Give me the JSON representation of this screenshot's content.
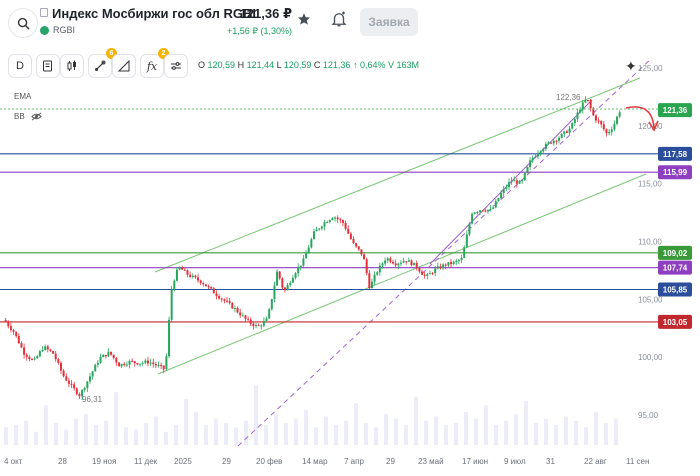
{
  "header": {
    "title": "Индекс Мосбиржи гос обл RGBI",
    "ticker": "RGBI",
    "price": "121,36 ₽",
    "change": "+1,56 ₽ (1,30%)",
    "order_button": "Заявка"
  },
  "toolbar": {
    "d_label": "D",
    "badge_drawing": "6",
    "badge_fx": "2",
    "fx_label": "fx",
    "ohlc": {
      "o_label": "O",
      "o": "120,59",
      "h_label": "H",
      "h": "121,44",
      "l_label": "L",
      "l": "120,59",
      "c_label": "C",
      "c": "121,36",
      "change": "↑ 0,64% V 163M"
    }
  },
  "indicators": {
    "ema": "EMA",
    "bb": "BB"
  },
  "colors": {
    "up": "#26a65b",
    "down": "#e0303a",
    "channel": "#6cc26a",
    "trend": "#9b59d0",
    "blue": "#2a4e9b",
    "red": "#c0282e",
    "green_level": "#3a9a3a",
    "purple_level": "#8e3fbf"
  },
  "annotations": {
    "high_label": "122,36",
    "low_label": "96,31"
  },
  "level_lines": [
    {
      "label": "117,58",
      "value": 117.58,
      "color": "#2a4e9b"
    },
    {
      "label": "115,99",
      "value": 115.99,
      "color": "#8e3fbf"
    },
    {
      "label": "109,02",
      "value": 109.02,
      "color": "#3a9a3a"
    },
    {
      "label": "107,74",
      "value": 107.74,
      "color": "#8e3fbf"
    },
    {
      "label": "105,85",
      "value": 105.85,
      "color": "#2a4e9b"
    },
    {
      "label": "103,05",
      "value": 103.05,
      "color": "#c0282e"
    }
  ],
  "current_price": {
    "label": "121,36",
    "value": 121.36
  },
  "chart_data": {
    "type": "candlestick",
    "y_ticks": [
      "125,00",
      "120,00",
      "115,00",
      "110,00",
      "105,00",
      "100,00",
      "95,00"
    ],
    "y_tick_values": [
      125,
      120,
      115,
      110,
      105,
      100,
      95
    ],
    "x_ticks": [
      "4 окт",
      "28",
      "19 ноя",
      "11 дек",
      "2025",
      "29",
      "20 фев",
      "14 мар",
      "7 апр",
      "29",
      "23 май",
      "17 июн",
      "9 июл",
      "31",
      "22 авг",
      "11 сен"
    ],
    "price_path": [
      [
        0,
        103.2
      ],
      [
        6,
        102.2
      ],
      [
        12,
        100.4
      ],
      [
        18,
        99.6
      ],
      [
        24,
        100.9
      ],
      [
        30,
        100.3
      ],
      [
        36,
        98.4
      ],
      [
        42,
        97.3
      ],
      [
        46,
        96.7
      ],
      [
        52,
        98.3
      ],
      [
        58,
        99.9
      ],
      [
        64,
        100.4
      ],
      [
        70,
        99.3
      ],
      [
        76,
        99.6
      ],
      [
        82,
        99.5
      ],
      [
        88,
        99.6
      ],
      [
        94,
        99.2
      ],
      [
        98,
        98.9
      ],
      [
        100,
        102.8
      ],
      [
        102,
        106.2
      ],
      [
        106,
        107.8
      ],
      [
        112,
        107.1
      ],
      [
        120,
        106.5
      ],
      [
        130,
        105.3
      ],
      [
        140,
        104.2
      ],
      [
        148,
        103.1
      ],
      [
        154,
        102.6
      ],
      [
        160,
        103.3
      ],
      [
        166,
        107.5
      ],
      [
        170,
        105.6
      ],
      [
        176,
        107.2
      ],
      [
        182,
        108.4
      ],
      [
        188,
        110.7
      ],
      [
        194,
        111.6
      ],
      [
        200,
        112.2
      ],
      [
        206,
        111.6
      ],
      [
        212,
        109.8
      ],
      [
        218,
        108.8
      ],
      [
        222,
        106.0
      ],
      [
        226,
        107.3
      ],
      [
        232,
        108.6
      ],
      [
        238,
        108.1
      ],
      [
        244,
        108.4
      ],
      [
        250,
        107.9
      ],
      [
        256,
        106.9
      ],
      [
        262,
        107.6
      ],
      [
        268,
        108.0
      ],
      [
        274,
        108.2
      ],
      [
        278,
        108.5
      ],
      [
        284,
        112.5
      ],
      [
        290,
        112.8
      ],
      [
        296,
        112.7
      ],
      [
        302,
        114.2
      ],
      [
        308,
        115.3
      ],
      [
        314,
        115.0
      ],
      [
        320,
        117.1
      ],
      [
        326,
        118.0
      ],
      [
        332,
        118.6
      ],
      [
        338,
        119.1
      ],
      [
        344,
        119.8
      ],
      [
        350,
        121.6
      ],
      [
        354,
        122.36
      ],
      [
        358,
        120.8
      ],
      [
        362,
        120.2
      ],
      [
        366,
        119.3
      ],
      [
        370,
        120.0
      ],
      [
        374,
        121.36
      ]
    ],
    "volume": [
      8,
      9,
      11,
      6,
      18,
      10,
      7,
      12,
      14,
      9,
      11,
      24,
      8,
      7,
      10,
      13,
      6,
      9,
      21,
      15,
      9,
      12,
      10,
      8,
      11,
      27,
      9,
      14,
      10,
      12,
      16,
      8,
      13,
      9,
      11,
      19,
      10,
      8,
      14,
      12,
      9,
      22,
      11,
      13,
      9,
      10,
      15,
      12,
      18,
      9,
      11,
      14,
      20,
      10,
      12,
      9,
      13,
      11,
      8,
      15,
      10,
      12
    ]
  }
}
